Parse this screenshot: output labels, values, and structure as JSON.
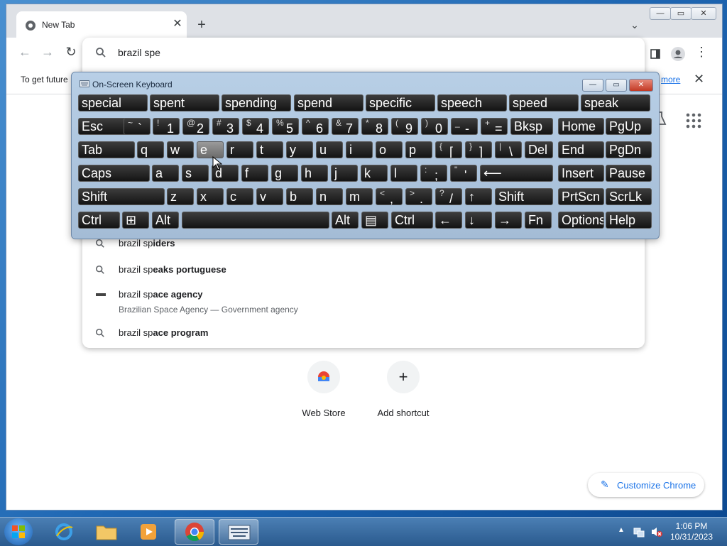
{
  "chrome": {
    "tab_title": "New Tab",
    "omnibox_value": "brazil spe",
    "infobar_text": "To get future",
    "infobar_link": "more",
    "suggestions": [
      {
        "prefix": "brazil sp",
        "bold": "iders",
        "sub": ""
      },
      {
        "prefix": "brazil sp",
        "bold": "eaks portuguese",
        "sub": ""
      },
      {
        "prefix": "brazil sp",
        "bold": "ace agency",
        "sub": "Brazilian Space Agency — Government agency"
      },
      {
        "prefix": "brazil sp",
        "bold": "ace program",
        "sub": ""
      }
    ],
    "shortcuts": [
      {
        "label": "Web Store",
        "icon": "chrome-web-store-icon"
      },
      {
        "label": "Add shortcut",
        "icon": "plus-icon"
      }
    ],
    "customize_label": "Customize Chrome"
  },
  "osk": {
    "title": "On-Screen Keyboard",
    "predictions": [
      "special",
      "spent",
      "spending",
      "spend",
      "specific",
      "speech",
      "speed",
      "speak"
    ],
    "rows": [
      [
        [
          "Esc",
          ""
        ],
        [
          "`",
          "~"
        ],
        [
          "1",
          "!"
        ],
        [
          "2",
          "@"
        ],
        [
          "3",
          "#"
        ],
        [
          "4",
          "$"
        ],
        [
          "5",
          "%"
        ],
        [
          "6",
          "^"
        ],
        [
          "7",
          "&"
        ],
        [
          "8",
          "*"
        ],
        [
          "9",
          "("
        ],
        [
          "0",
          ")"
        ],
        [
          "-",
          "_"
        ],
        [
          "=",
          "+"
        ],
        [
          "Bksp",
          ""
        ],
        [
          "Home",
          ""
        ],
        [
          "PgUp",
          ""
        ]
      ],
      [
        [
          "Tab",
          ""
        ],
        [
          "q",
          ""
        ],
        [
          "w",
          ""
        ],
        [
          "e",
          ""
        ],
        [
          "r",
          ""
        ],
        [
          "t",
          ""
        ],
        [
          "y",
          ""
        ],
        [
          "u",
          ""
        ],
        [
          "i",
          ""
        ],
        [
          "o",
          ""
        ],
        [
          "p",
          ""
        ],
        [
          "[",
          "{"
        ],
        [
          "]",
          "}"
        ],
        [
          "\\",
          "|"
        ],
        [
          "Del",
          ""
        ],
        [
          "End",
          ""
        ],
        [
          "PgDn",
          ""
        ]
      ],
      [
        [
          "Caps",
          ""
        ],
        [
          "a",
          ""
        ],
        [
          "s",
          ""
        ],
        [
          "d",
          ""
        ],
        [
          "f",
          ""
        ],
        [
          "g",
          ""
        ],
        [
          "h",
          ""
        ],
        [
          "j",
          ""
        ],
        [
          "k",
          ""
        ],
        [
          "l",
          ""
        ],
        [
          ";",
          ":"
        ],
        [
          "'",
          "\""
        ],
        [
          "⟵",
          ""
        ],
        [
          "Insert",
          ""
        ],
        [
          "Pause",
          ""
        ]
      ],
      [
        [
          "Shift",
          ""
        ],
        [
          "z",
          ""
        ],
        [
          "x",
          ""
        ],
        [
          "c",
          ""
        ],
        [
          "v",
          ""
        ],
        [
          "b",
          ""
        ],
        [
          "n",
          ""
        ],
        [
          "m",
          ""
        ],
        [
          ",",
          "<"
        ],
        [
          ".",
          ">"
        ],
        [
          "/",
          "?"
        ],
        [
          "↑",
          ""
        ],
        [
          "Shift",
          ""
        ],
        [
          "PrtScn",
          ""
        ],
        [
          "ScrLk",
          ""
        ]
      ],
      [
        [
          "Ctrl",
          ""
        ],
        [
          "⊞",
          ""
        ],
        [
          "Alt",
          ""
        ],
        [
          "",
          ""
        ],
        [
          "Alt",
          ""
        ],
        [
          "▤",
          ""
        ],
        [
          "Ctrl",
          ""
        ],
        [
          "←",
          ""
        ],
        [
          "↓",
          ""
        ],
        [
          "→",
          ""
        ],
        [
          "Fn",
          ""
        ],
        [
          "Options",
          ""
        ],
        [
          "Help",
          ""
        ]
      ]
    ]
  },
  "taskbar": {
    "time": "1:06 PM",
    "date": "10/31/2023",
    "items": [
      "start-button",
      "internet-explorer-icon",
      "file-explorer-icon",
      "media-player-icon",
      "chrome-icon",
      "on-screen-keyboard-icon"
    ]
  }
}
